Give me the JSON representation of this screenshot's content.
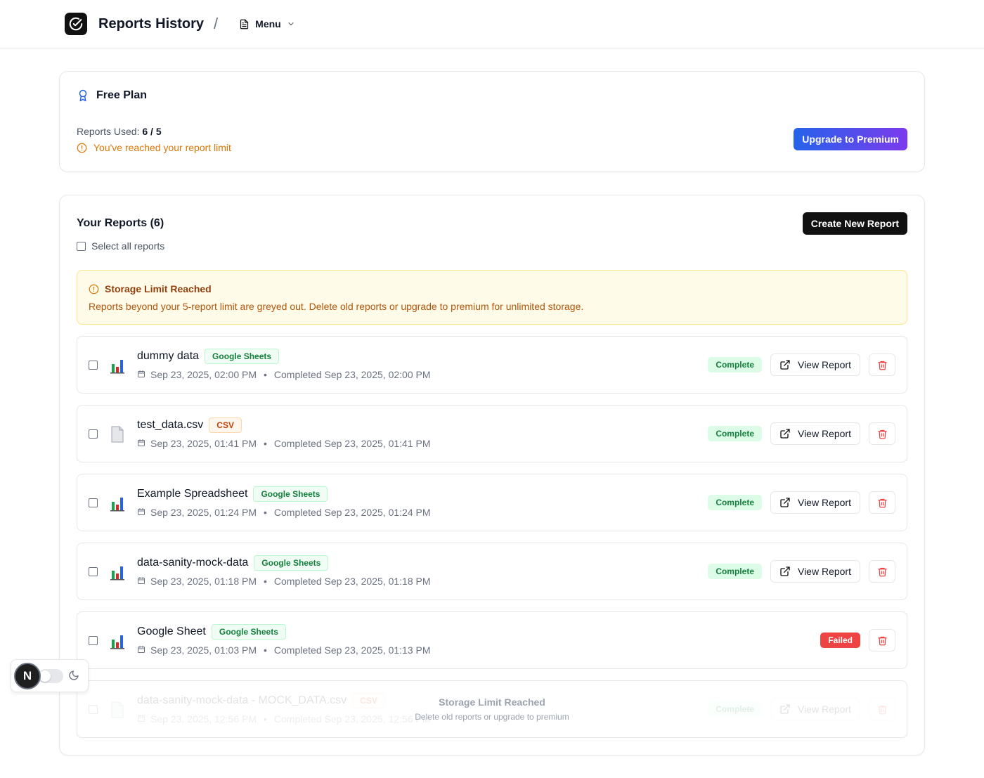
{
  "header": {
    "title": "Reports History",
    "separator": "/",
    "menu_label": "Menu"
  },
  "plan": {
    "title": "Free Plan",
    "used_label": "Reports Used:",
    "used_value": "6 / 5",
    "limit_warning": "You've reached your report limit",
    "upgrade_label": "Upgrade to Premium"
  },
  "reports": {
    "title": "Your Reports (6)",
    "select_all_label": "Select all reports",
    "create_label": "Create New Report",
    "storage_warning": {
      "title": "Storage Limit Reached",
      "text": "Reports beyond your 5-report limit are greyed out. Delete old reports or upgrade to premium for unlimited storage."
    },
    "items": [
      {
        "name": "dummy data",
        "source": "Google Sheets",
        "source_type": "sheets",
        "created": "Sep 23, 2025, 02:00 PM",
        "completed": "Completed Sep 23, 2025, 02:00 PM",
        "status": "Complete",
        "view_label": "View Report"
      },
      {
        "name": "test_data.csv",
        "source": "CSV",
        "source_type": "csv",
        "created": "Sep 23, 2025, 01:41 PM",
        "completed": "Completed Sep 23, 2025, 01:41 PM",
        "status": "Complete",
        "view_label": "View Report"
      },
      {
        "name": "Example Spreadsheet",
        "source": "Google Sheets",
        "source_type": "sheets",
        "created": "Sep 23, 2025, 01:24 PM",
        "completed": "Completed Sep 23, 2025, 01:24 PM",
        "status": "Complete",
        "view_label": "View Report"
      },
      {
        "name": "data-sanity-mock-data",
        "source": "Google Sheets",
        "source_type": "sheets",
        "created": "Sep 23, 2025, 01:18 PM",
        "completed": "Completed Sep 23, 2025, 01:18 PM",
        "status": "Complete",
        "view_label": "View Report"
      },
      {
        "name": "Google Sheet",
        "source": "Google Sheets",
        "source_type": "sheets",
        "created": "Sep 23, 2025, 01:03 PM",
        "completed": "Completed Sep 23, 2025, 01:13 PM",
        "status": "Failed",
        "view_label": ""
      },
      {
        "name": "data-sanity-mock-data - MOCK_DATA.csv",
        "source": "CSV",
        "source_type": "csv",
        "created": "Sep 23, 2025, 12:56 PM",
        "completed": "Completed Sep 23, 2025, 12:56 PM",
        "status": "Complete",
        "view_label": "View Report"
      }
    ],
    "greyed_overlay": {
      "title": "Storage Limit Reached",
      "subtitle": "Delete old reports or upgrade to premium"
    }
  },
  "dev_widget": {
    "badge": "N"
  },
  "colors": {
    "accent_gradient_start": "#2563eb",
    "accent_gradient_end": "#7c3aed",
    "warning": "#d97706",
    "success": "#15803d",
    "danger": "#ef4444"
  }
}
